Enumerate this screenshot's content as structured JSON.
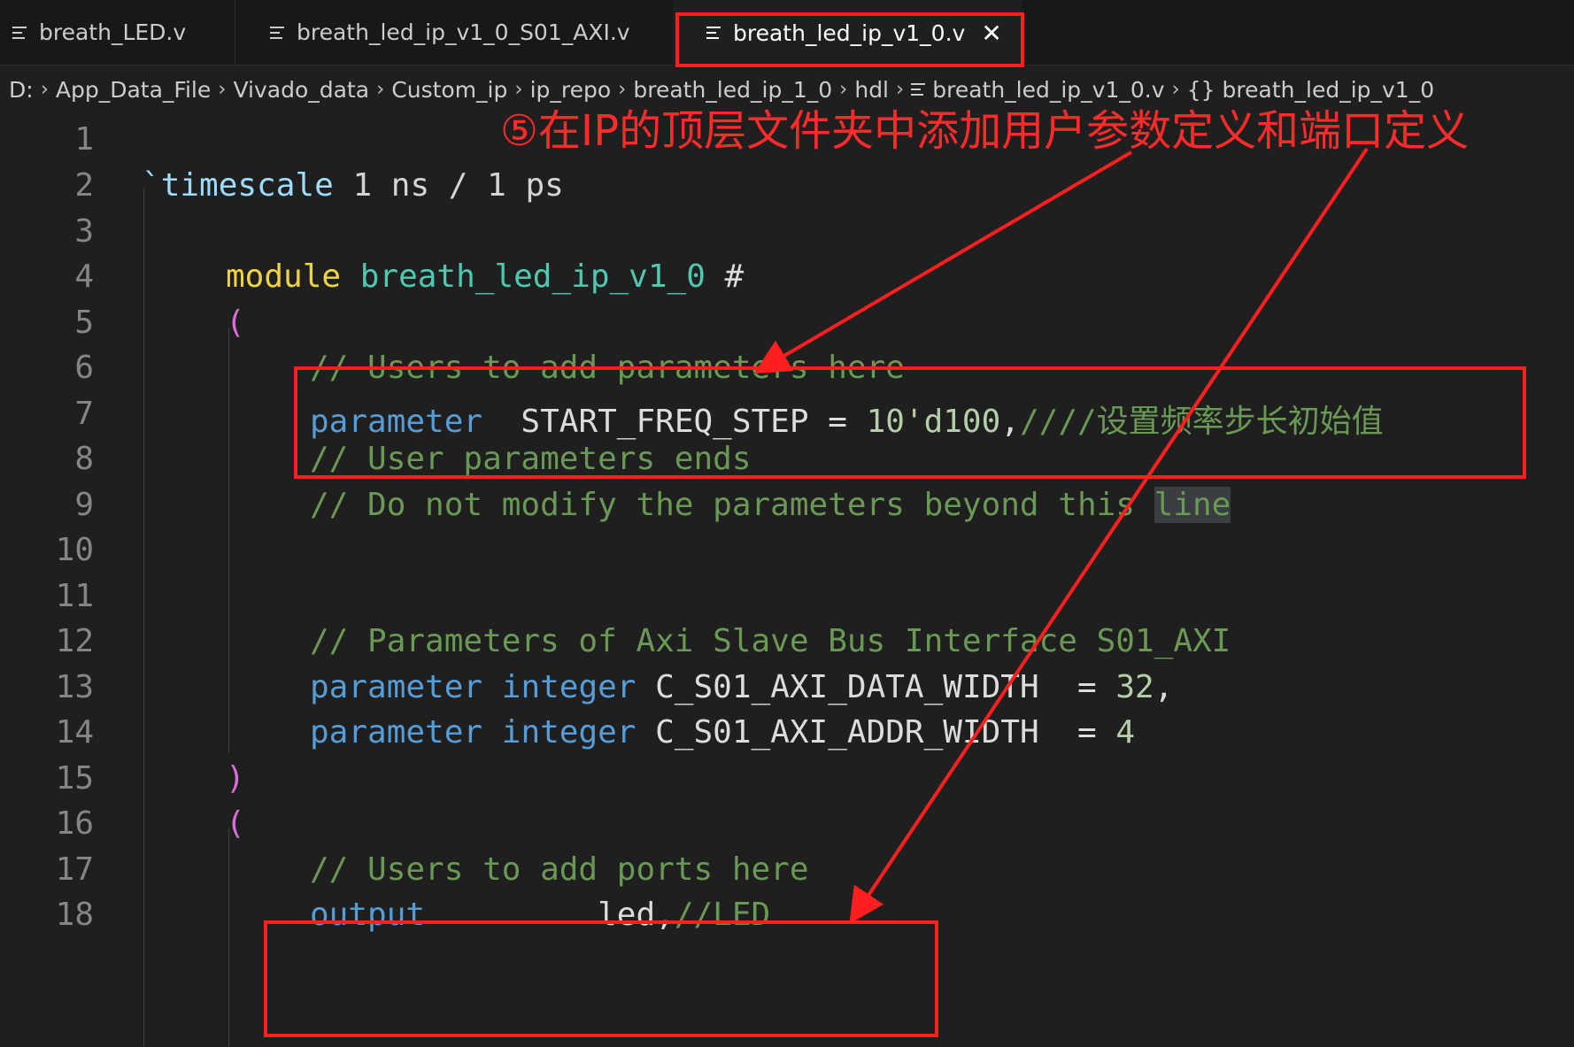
{
  "tabs": [
    {
      "label": "breath_LED.v"
    },
    {
      "label": "breath_led_ip_v1_0_S01_AXI.v"
    },
    {
      "label": "breath_led_ip_v1_0.v",
      "close": "✕"
    }
  ],
  "breadcrumb": {
    "items": [
      "D:",
      "App_Data_File",
      "Vivado_data",
      "Custom_ip",
      "ip_repo",
      "breath_led_ip_1_0",
      "hdl"
    ],
    "file": "breath_led_ip_v1_0.v",
    "symbol_glyph": "{}",
    "symbol": "breath_led_ip_v1_0",
    "separator": "›"
  },
  "annotation": {
    "text": "⑤在IP的顶层文件夹中添加用户参数定义和端口定义",
    "color": "#ff1f1f"
  },
  "editor": {
    "line_numbers": [
      "1",
      "2",
      "3",
      "4",
      "5",
      "6",
      "7",
      "8",
      "9",
      "10",
      "11",
      "12",
      "13",
      "14",
      "15",
      "16",
      "17",
      "18"
    ],
    "lines": {
      "l2": {
        "tick": "`",
        "keyword": "timescale",
        "rest": " 1 ns / 1 ps"
      },
      "l4": {
        "keyword": "module",
        "name": "breath_led_ip_v1_0",
        "rest": " #"
      },
      "l5": {
        "paren": "("
      },
      "l6": {
        "comment": "// Users to add parameters here"
      },
      "l7": {
        "keyword": "parameter",
        "name": "  START_FREQ_STEP = ",
        "value": "10'd100",
        "punct": ",",
        "comment": "////设置频率步长初始值"
      },
      "l8": {
        "comment": "// User parameters ends"
      },
      "l9": {
        "comment": "// Do not modify the parameters beyond this ",
        "highlight": "line"
      },
      "l12": {
        "comment": "// Parameters of Axi Slave Bus Interface S01_AXI"
      },
      "l13": {
        "keyword": "parameter",
        "type": "integer",
        "name": " C_S01_AXI_DATA_WIDTH  = ",
        "value": "32",
        "punct": ","
      },
      "l14": {
        "keyword": "parameter",
        "type": "integer",
        "name": " C_S01_AXI_ADDR_WIDTH  = ",
        "value": "4"
      },
      "l15": {
        "paren": ")"
      },
      "l16": {
        "paren": "("
      },
      "l17": {
        "comment": "// Users to add ports here"
      },
      "l18": {
        "keyword": "output",
        "name": "         led,",
        "comment": "//LED"
      }
    }
  }
}
